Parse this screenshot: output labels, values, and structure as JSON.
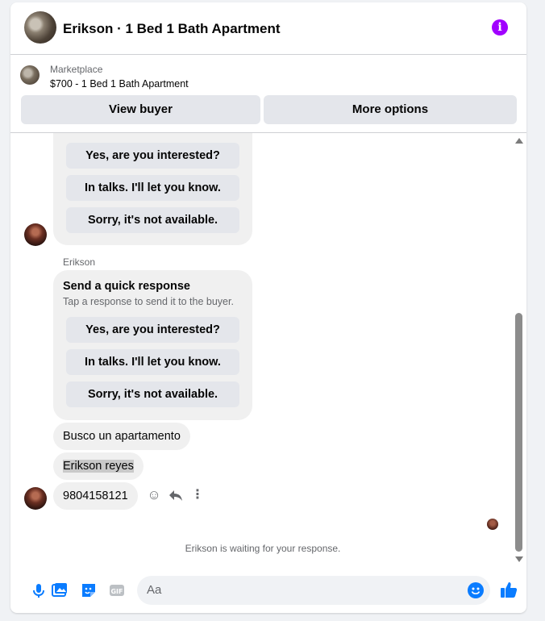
{
  "colors": {
    "accent": "#0a7cff",
    "info": "#a100ff",
    "bubble": "#f0f0f0",
    "button": "#e4e6eb"
  },
  "header": {
    "title": "Erikson · 1 Bed 1 Bath Apartment",
    "info_icon": "info-icon"
  },
  "listing": {
    "source": "Marketplace",
    "name": "$700 - 1 Bed 1 Bath Apartment",
    "buttons": {
      "view_buyer": "View buyer",
      "more_options": "More options"
    }
  },
  "conversation": {
    "card_top": {
      "responses": [
        "Yes, are you interested?",
        "In talks. I'll let you know.",
        "Sorry, it's not available."
      ]
    },
    "sender": "Erikson",
    "card": {
      "title": "Send a quick response",
      "subtitle": "Tap a response to send it to the buyer.",
      "responses": [
        "Yes, are you interested?",
        "In talks. I'll let you know.",
        "Sorry, it's not available."
      ]
    },
    "messages": [
      "Busco un apartamento",
      "Erikson reyes",
      "9804158121"
    ],
    "status": "Erikson is waiting for your response."
  },
  "composer": {
    "placeholder": "Aa",
    "icons": [
      "microphone-icon",
      "photo-icon",
      "sticker-icon",
      "gif-icon",
      "emoji-icon",
      "like-icon"
    ]
  }
}
